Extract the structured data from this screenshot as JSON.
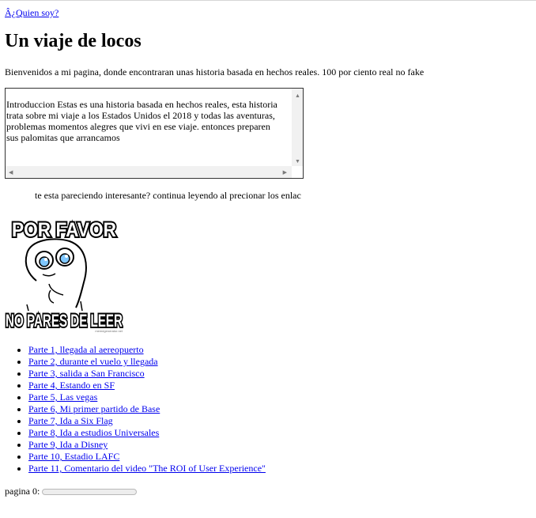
{
  "nav": {
    "about_link": "Â¿Quien soy?"
  },
  "title": "Un viaje de locos",
  "intro": "Bienvenidos a mi pagina, donde encontraran unas historia basada en hechos reales. 100 por ciento real no fake",
  "textbox": {
    "text": "Introduccion Estas es una historia basada en hechos reales, esta historia trata sobre mi viaje a los Estados Unidos el 2018 y todas las aventuras, problemas momentos alegres que vivi en ese viaje. entonces preparen sus palomitas que arrancamos"
  },
  "teaser": "te esta pareciendo interesante? continua leyendo al precionar los enlac",
  "meme": {
    "top_text": "POR FAVOR",
    "bottom_text": "NO PARES DE LEER",
    "watermark": "memegenerator.net"
  },
  "parts": [
    "Parte 1, llegada al aereopuerto",
    "Parte 2, durante el vuelo y llegada",
    "Parte 3, salida a San Francisco",
    "Parte 4, Estando en SF",
    "Parte 5, Las vegas",
    "Parte 6, Mi primer partido de Base",
    "Parte 7, Ida a Six Flag",
    "Parte 8, Ida a estudios Universales",
    "Parte 9, Ida a Disney",
    "Parte 10, Estadio LAFC",
    "Parte 11, Comentario del video \"The ROI of User Experience\""
  ],
  "progress": {
    "label": "pagina 0:",
    "value": 0
  }
}
